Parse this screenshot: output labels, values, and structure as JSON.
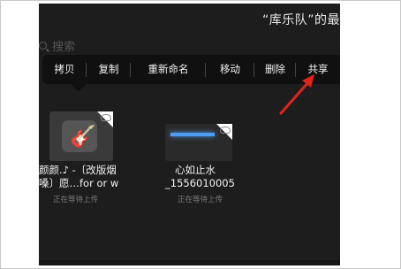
{
  "header": {
    "title": "“库乐队”的最"
  },
  "search": {
    "placeholder": "搜索"
  },
  "context_menu": {
    "items": [
      {
        "label": "拷贝"
      },
      {
        "label": "复制"
      },
      {
        "label": "重新命名"
      },
      {
        "label": "移动"
      },
      {
        "label": "删除"
      },
      {
        "label": "共享"
      }
    ]
  },
  "files": [
    {
      "name_line1": "颜颜.♪ -〔改版烟",
      "name_line2": "嗓〕愿…for or w",
      "status": "正在等待上传",
      "icon": "guitar-icon"
    },
    {
      "name_line1": "心如止水",
      "name_line2": "_1556010005",
      "status": "正在等待上传",
      "icon": "video-thumbnail"
    }
  ],
  "colors": {
    "background": "#1d1d1d",
    "menu": "#101010",
    "arrow": "#e0241b",
    "video_accent": "#4f9df3"
  }
}
